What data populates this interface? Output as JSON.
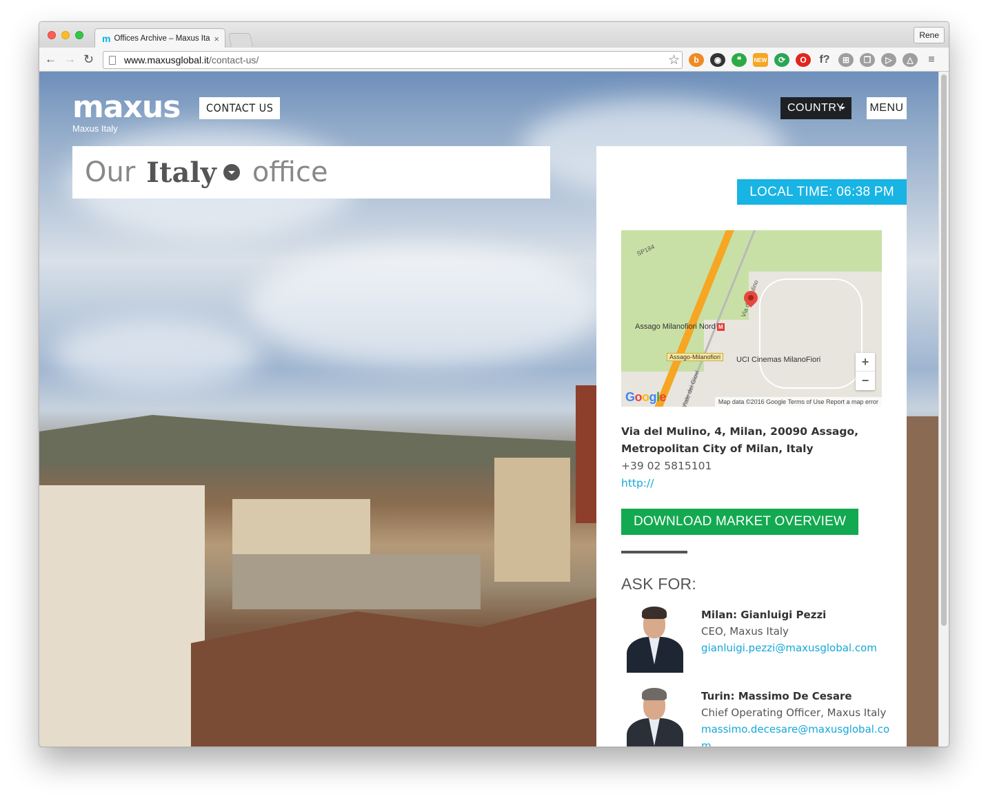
{
  "browser": {
    "tab_title": "Offices Archive – Maxus Ita",
    "tab_favicon": "m",
    "tab_close": "×",
    "user_button": "Rene",
    "url_host": "www.maxusglobal.it",
    "url_path": "/contact-us/",
    "nav": {
      "back": "←",
      "forward": "→",
      "reload": "↻",
      "bookmark": "☆"
    },
    "extensions": [
      {
        "name": "hotspot-icon",
        "glyph": "b",
        "color": "#f08a24"
      },
      {
        "name": "camera-icon",
        "glyph": "◉",
        "color": "#333333"
      },
      {
        "name": "hangouts-icon",
        "glyph": "❝",
        "color": "#2eaa45"
      },
      {
        "name": "new-badge-icon",
        "glyph": "NEW",
        "color": "#f5a623"
      },
      {
        "name": "sync-icon",
        "glyph": "⟳",
        "color": "#2aa556"
      },
      {
        "name": "opera-icon",
        "glyph": "O",
        "color": "#e0261c"
      },
      {
        "name": "font-finder-icon",
        "glyph": "f?",
        "color": "transparent"
      },
      {
        "name": "puzzle-icon",
        "glyph": "⊞",
        "color": "#9e9e9e"
      },
      {
        "name": "copy-icon",
        "glyph": "❐",
        "color": "#9e9e9e"
      },
      {
        "name": "cast-icon",
        "glyph": "▷",
        "color": "#9e9e9e"
      },
      {
        "name": "drive-icon",
        "glyph": "△",
        "color": "#9e9e9e"
      },
      {
        "name": "menu-icon",
        "glyph": "≡",
        "color": "transparent"
      }
    ]
  },
  "site": {
    "logo": "maxus",
    "logo_sub": "Maxus Italy",
    "contact_button": "CONTACT US",
    "country_button": "COUNTRY",
    "menu_button": "MENU",
    "heading": {
      "prefix": "Our",
      "country": "Italy",
      "suffix": "office"
    }
  },
  "office": {
    "local_time": "LOCAL TIME: 06:38 PM",
    "map": {
      "label_road": "SP184",
      "label_station": "Assago Milanofiori Nord",
      "label_station_tag": "Assago-Milanofiori",
      "label_street": "Via del Mulino",
      "label_cinema": "UCI Cinemas MilanoFiori",
      "label_giovi": "Viale dei Giovi",
      "attribution": "Map data ©2016 Google   Terms of Use   Report a map error",
      "zoom_in": "+",
      "zoom_out": "−"
    },
    "address_line1": "Via del Mulino, 4, Milan, 20090 Assago,",
    "address_line2": "Metropolitan City of Milan, Italy",
    "phone": "+39 02 5815101",
    "website": "http://",
    "download_button": "DOWNLOAD MARKET OVERVIEW",
    "ask_for_title": "ASK FOR:",
    "contacts": [
      {
        "name": "Milan: Gianluigi Pezzi",
        "role": "CEO, Maxus Italy",
        "email": "gianluigi.pezzi@maxusglobal.com"
      },
      {
        "name": "Turin: Massimo De Cesare",
        "role": "Chief Operating Officer, Maxus Italy",
        "email": "massimo.decesare@maxusglobal.com"
      }
    ]
  },
  "colors": {
    "accent_blue": "#18b4e4",
    "download_green": "#13a950",
    "dark_button": "#1e2124"
  }
}
